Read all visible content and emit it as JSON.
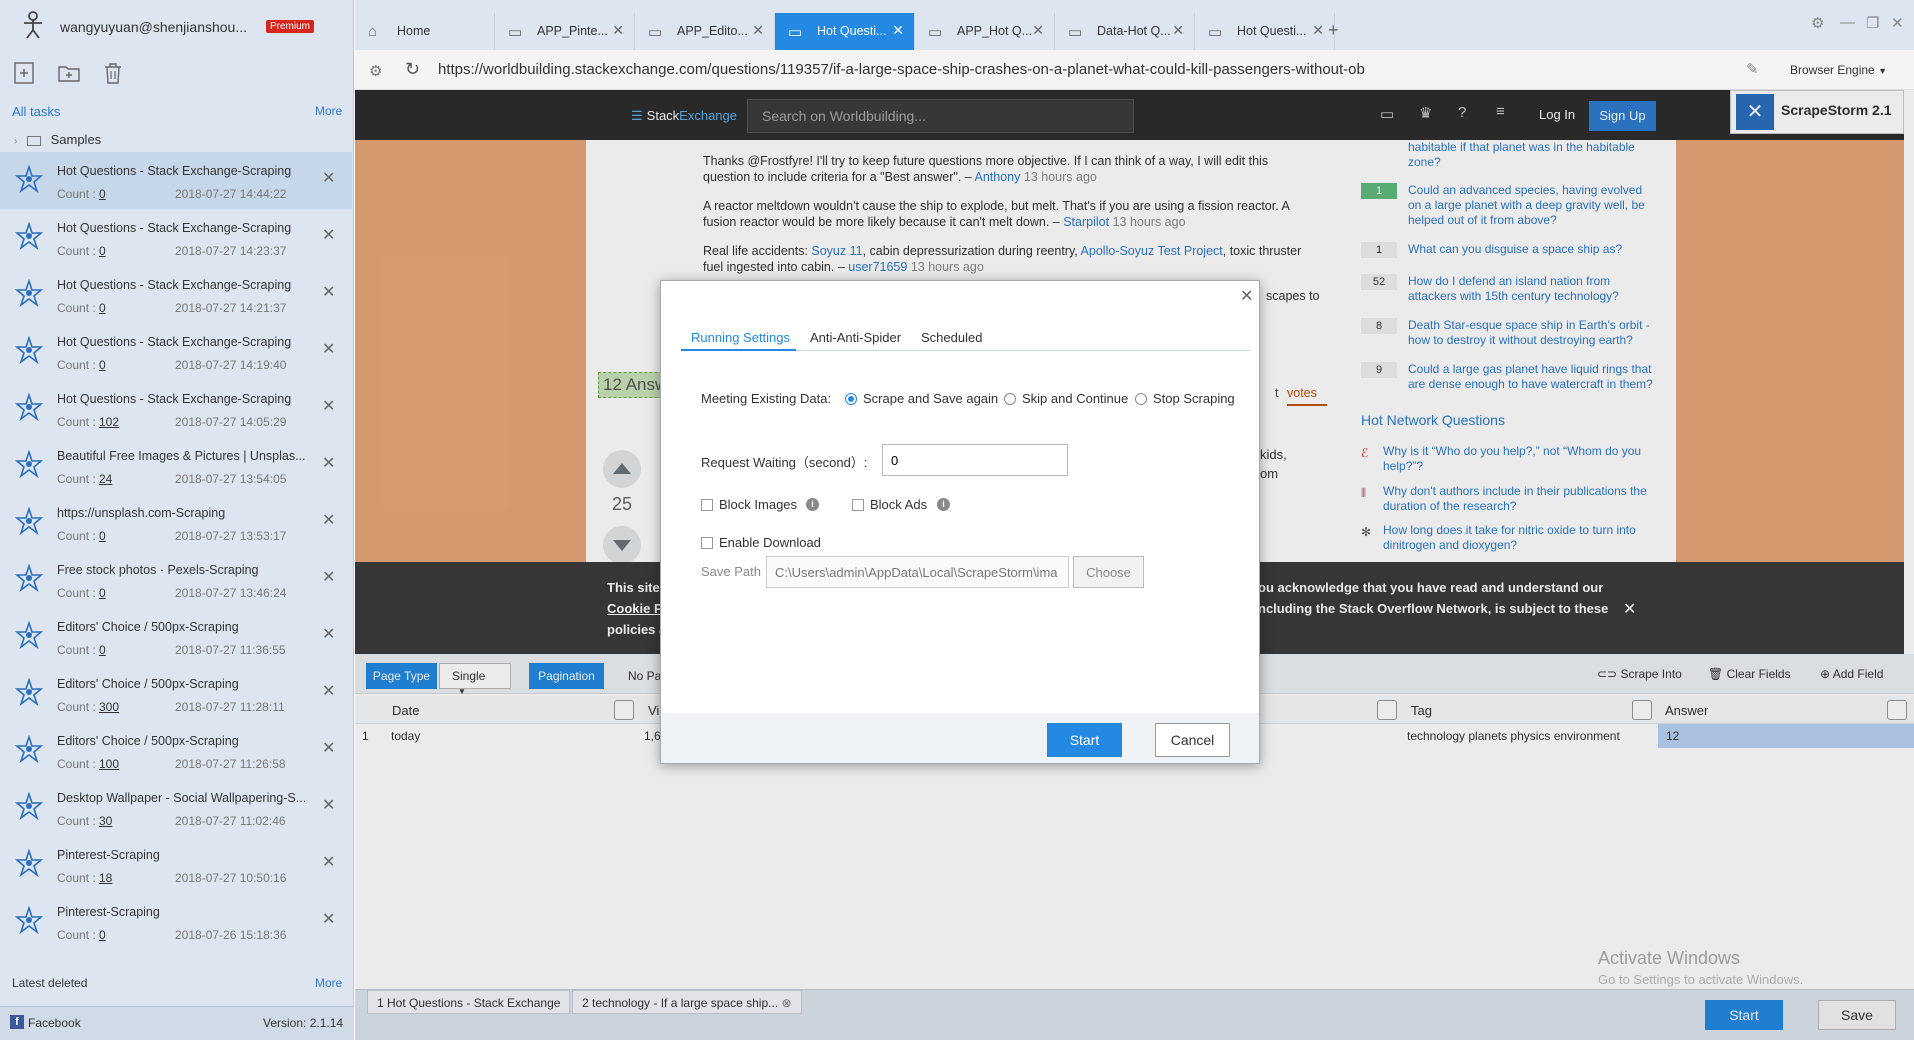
{
  "sidebar": {
    "user": "wangyuyuan@shenjianshou...",
    "premium_badge": "Premium",
    "all_tasks": "All tasks",
    "more": "More",
    "samples": "Samples",
    "tasks": [
      {
        "title": "Hot Questions - Stack Exchange-Scraping",
        "count_label": "Count :",
        "count": "0",
        "date": "2018-07-27 14:44:22"
      },
      {
        "title": "Hot Questions - Stack Exchange-Scraping",
        "count_label": "Count :",
        "count": "0",
        "date": "2018-07-27 14:23:37"
      },
      {
        "title": "Hot Questions - Stack Exchange-Scraping",
        "count_label": "Count :",
        "count": "0",
        "date": "2018-07-27 14:21:37"
      },
      {
        "title": "Hot Questions - Stack Exchange-Scraping",
        "count_label": "Count :",
        "count": "0",
        "date": "2018-07-27 14:19:40"
      },
      {
        "title": "Hot Questions - Stack Exchange-Scraping",
        "count_label": "Count :",
        "count": "102",
        "date": "2018-07-27 14:05:29"
      },
      {
        "title": "Beautiful Free Images & Pictures | Unsplas...",
        "count_label": "Count :",
        "count": "24",
        "date": "2018-07-27 13:54:05"
      },
      {
        "title": "https://unsplash.com-Scraping",
        "count_label": "Count :",
        "count": "0",
        "date": "2018-07-27 13:53:17"
      },
      {
        "title": "Free stock photos · Pexels-Scraping",
        "count_label": "Count :",
        "count": "0",
        "date": "2018-07-27 13:46:24"
      },
      {
        "title": "Editors' Choice / 500px-Scraping",
        "count_label": "Count :",
        "count": "0",
        "date": "2018-07-27 11:36:55"
      },
      {
        "title": "Editors' Choice / 500px-Scraping",
        "count_label": "Count :",
        "count": "300",
        "date": "2018-07-27 11:28:11"
      },
      {
        "title": "Editors' Choice / 500px-Scraping",
        "count_label": "Count :",
        "count": "100",
        "date": "2018-07-27 11:26:58"
      },
      {
        "title": "Desktop Wallpaper - Social Wallpapering-S...",
        "count_label": "Count :",
        "count": "30",
        "date": "2018-07-27 11:02:46"
      },
      {
        "title": "Pinterest-Scraping",
        "count_label": "Count :",
        "count": "18",
        "date": "2018-07-27 10:50:16"
      },
      {
        "title": "Pinterest-Scraping",
        "count_label": "Count :",
        "count": "0",
        "date": "2018-07-26 15:18:36"
      }
    ],
    "latest_deleted": "Latest deleted",
    "facebook": "Facebook",
    "version": "Version: 2.1.14"
  },
  "browser": {
    "tabs": [
      {
        "label": "Home"
      },
      {
        "label": "APP_Pinte..."
      },
      {
        "label": "APP_Edito..."
      },
      {
        "label": "Hot Questi..."
      },
      {
        "label": "APP_Hot Q..."
      },
      {
        "label": "Data-Hot Q..."
      },
      {
        "label": "Hot Questi..."
      }
    ],
    "url": "https://worldbuilding.stackexchange.com/questions/119357/if-a-large-space-ship-crashes-on-a-planet-what-could-kill-passengers-without-ob",
    "engine": "Browser Engine"
  },
  "site": {
    "logo_a": "Stack",
    "logo_b": "Exchange",
    "search_placeholder": "Search on Worldbuilding...",
    "login": "Log In",
    "signup": "Sign Up",
    "scrapestorm_badge": "ScrapeStorm 2.1",
    "comments": [
      {
        "text": "Thanks @Frostfyre! I'll try to keep future questions more objective. If I can think of a way, I will edit this question to include criteria for a \"Best answer\". – ",
        "author": "Anthony",
        "time": "13 hours ago"
      },
      {
        "text": "A reactor meltdown wouldn't cause the ship to explode, but melt. That's if you are using a fission reactor. A fusion reactor would be more likely because it can't melt down. – ",
        "author": "Starpilot",
        "time": "13 hours ago"
      },
      {
        "text_a": "Real life accidents: ",
        "link1": "Soyuz 11",
        "text_b": ", cabin depressurization during reentry, ",
        "link2": "Apollo-Soyuz Test Project",
        "text_c": ", toxic thruster fuel ingested into cabin. – ",
        "author": "user71659",
        "time": "13 hours ago"
      }
    ],
    "comment_tail": "scapes to",
    "answers_count_text": "12 Answ",
    "votes_tab": "votes",
    "vote_count": "25",
    "snippet1": "kids,",
    "snippet2": "om",
    "related": [
      {
        "count": "",
        "q": "habitable if that planet was in the habitable zone?"
      },
      {
        "count": "1",
        "q": "Could an advanced species, having evolved on a large planet with a deep gravity well, be helped out of it from above?",
        "answered": true
      },
      {
        "count": "1",
        "q": "What can you disguise a space ship as?"
      },
      {
        "count": "52",
        "q": "How do I defend an island nation from attackers with 15th century technology?"
      },
      {
        "count": "8",
        "q": "Death Star-esque space ship in Earth's orbit - how to destroy it without destroying earth?"
      },
      {
        "count": "9",
        "q": "Could a large gas planet have liquid rings that are dense enough to have watercraft in them?"
      }
    ],
    "hnq_title": "Hot Network Questions",
    "hnq": [
      "Why is it “Who do you help?,” not “Whom do you help?”?",
      "Why don't authors include in their publications the duration of the research?",
      "How long does it take for nitric oxide to turn into dinitrogen and dioxygen?"
    ],
    "cookie_l1": "This site",
    "cookie_l2": "Cookie P",
    "cookie_l3": "policies a",
    "cookie_r1": "ou acknowledge that you have read and understand our",
    "cookie_r2": "ncluding the Stack Overflow Network, is subject to these"
  },
  "config": {
    "page_type_label": "Page Type",
    "page_type_value": "Single",
    "pagination_label": "Pagination",
    "pagination_value": "No Pa",
    "scrape_into": "Scrape Into",
    "clear_fields": "Clear Fields",
    "add_field": "Add Field",
    "columns": [
      "Date",
      "Vi",
      "Tag",
      "Answer"
    ],
    "row": {
      "index": "1",
      "date": "today",
      "views": "1,6",
      "tag": "technology planets physics environment",
      "answer": "12"
    },
    "bottom_tabs": [
      "1 Hot Questions - Stack Exchange",
      "2 technology - If a large space ship..."
    ],
    "start": "Start",
    "save": "Save",
    "watermark1": "Activate Windows",
    "watermark2": "Go to Settings to activate Windows."
  },
  "modal": {
    "tabs": [
      "Running Settings",
      "Anti-Anti-Spider",
      "Scheduled"
    ],
    "existing_label": "Meeting Existing Data:",
    "options": [
      "Scrape and Save again",
      "Skip and Continue",
      "Stop Scraping"
    ],
    "request_label": "Request Waiting（second）:",
    "request_value": "0",
    "block_images": "Block Images",
    "block_ads": "Block Ads",
    "enable_download": "Enable Download",
    "save_path_label": "Save Path",
    "save_path_value": "C:\\Users\\admin\\AppData\\Local\\ScrapeStorm\\ima",
    "choose": "Choose",
    "start": "Start",
    "cancel": "Cancel"
  },
  "colors": {
    "accent": "#2389e3",
    "page_bg": "#e8a779",
    "sidebar_bg": "#dde6f0",
    "premium": "#d9261c"
  }
}
